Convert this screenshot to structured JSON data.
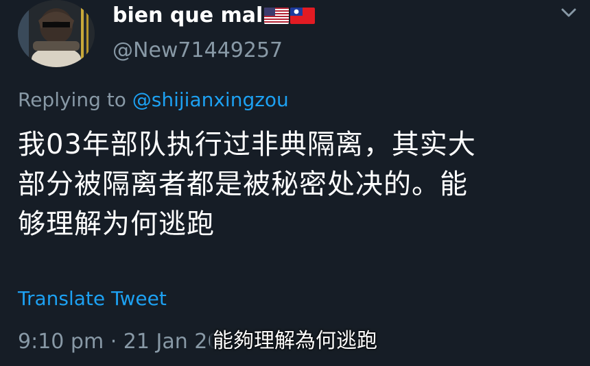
{
  "tweet": {
    "display_name": "bien que mal",
    "flags": [
      "us-flag-icon",
      "taiwan-flag-icon"
    ],
    "handle": "@New71449257",
    "reply_prefix": "Replying to",
    "reply_mention": "@shijianxingzou",
    "text_lines": [
      "我03年部队执行过非典隔离，其实大",
      "部分被隔离者都是被秘密处决的。能",
      "够理解为何逃跑"
    ],
    "translate_label": "Translate Tweet",
    "timestamp": "9:10 pm · 21 Jan 20"
  },
  "subtitle": {
    "text": "能夠理解為何逃跑"
  },
  "colors": {
    "background": "#161d26",
    "primary_text": "#ffffff",
    "secondary_text": "#8899a6",
    "accent": "#1da1f2"
  },
  "icons": {
    "menu": "chevron-down-icon",
    "avatar": "avatar"
  }
}
